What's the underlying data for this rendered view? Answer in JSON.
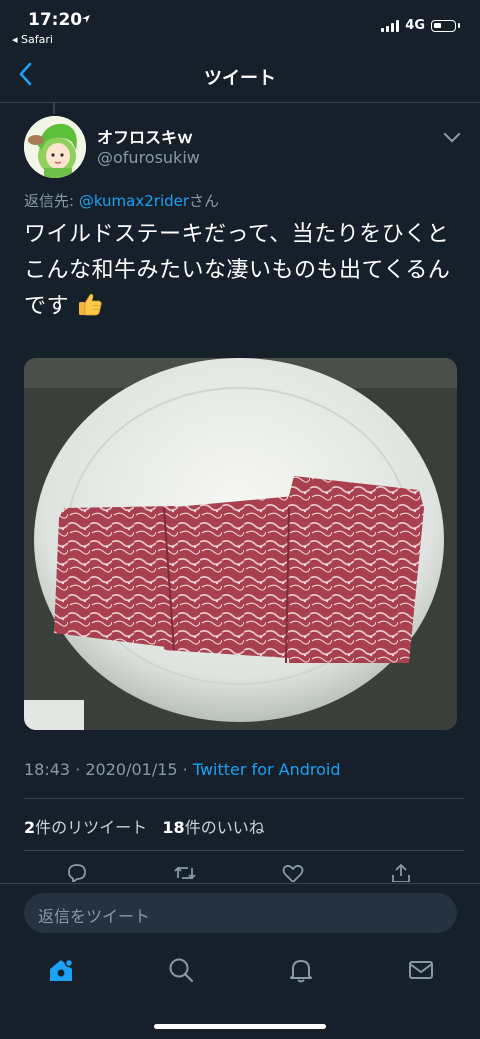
{
  "status_bar": {
    "time": "17:20",
    "back_app": "◂ Safari",
    "network": "4G"
  },
  "header": {
    "title": "ツイート",
    "back_icon": "chevron-left-icon"
  },
  "tweet": {
    "display_name": "オフロスキｗ",
    "handle": "@ofurosukiw",
    "reply_prefix": "返信先: ",
    "reply_mention": "@kumax2rider",
    "reply_suffix": "さん",
    "text": "ワイルドステーキだって、当たりをひくとこんな和牛みたいな凄いものも出てくるんです",
    "emoji": "thumbs-up-icon",
    "time": "18:43 · 2020/01/15 · ",
    "source": "Twitter for Android",
    "retweet_count": "2",
    "retweet_label": "件のリツイート",
    "like_count": "18",
    "like_label": "件のいいね"
  },
  "reply_bar": {
    "placeholder": "返信をツイート"
  },
  "tabbar": {
    "items": [
      "home-icon",
      "search-icon",
      "notifications-icon",
      "messages-icon"
    ],
    "active_color": "#1da1f2"
  },
  "colors": {
    "background": "#15202b",
    "accent": "#1da1f2",
    "secondary_text": "#8899a6"
  }
}
